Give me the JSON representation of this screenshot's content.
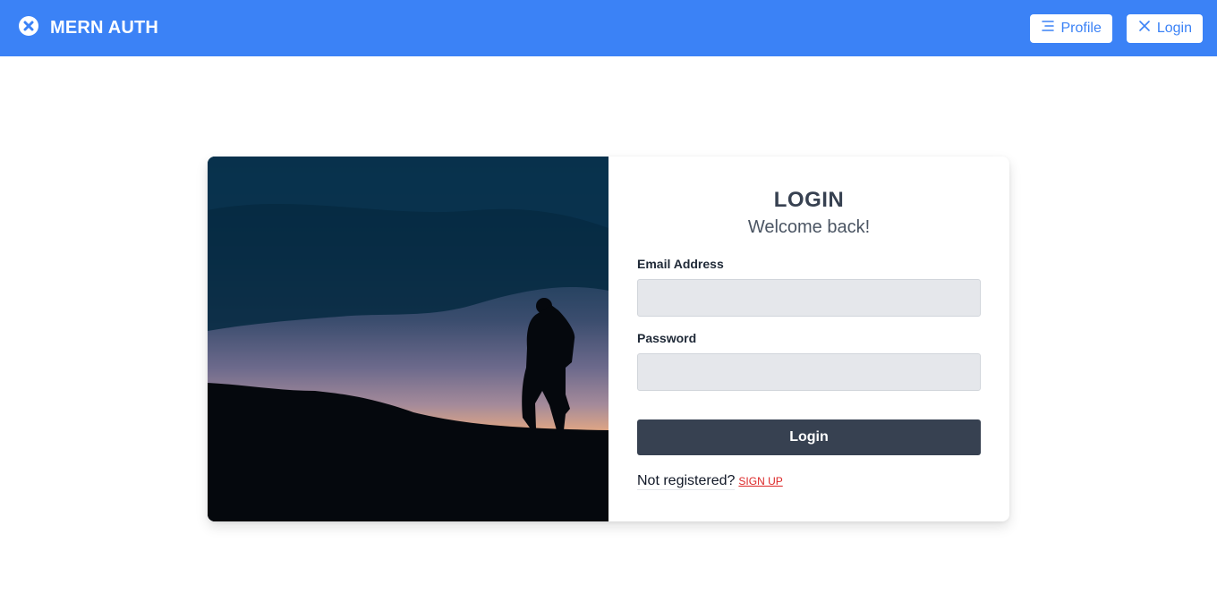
{
  "navbar": {
    "brand": "MERN AUTH",
    "brand_icon": "close-circle-icon",
    "color": "#3b82f6",
    "buttons": [
      {
        "label": "Profile",
        "icon": "menu-lines-icon"
      },
      {
        "label": "Login",
        "icon": "close-icon"
      }
    ]
  },
  "login": {
    "title": "LOGIN",
    "subtitle": "Welcome back!",
    "email_label": "Email Address",
    "email_value": "",
    "password_label": "Password",
    "password_value": "",
    "submit_label": "Login",
    "signup_prefix": "Not registered?",
    "signup_link": "SIGN UP"
  },
  "colors": {
    "accent": "#3b82f6",
    "button_dark": "#374151",
    "link": "#dc2626"
  }
}
